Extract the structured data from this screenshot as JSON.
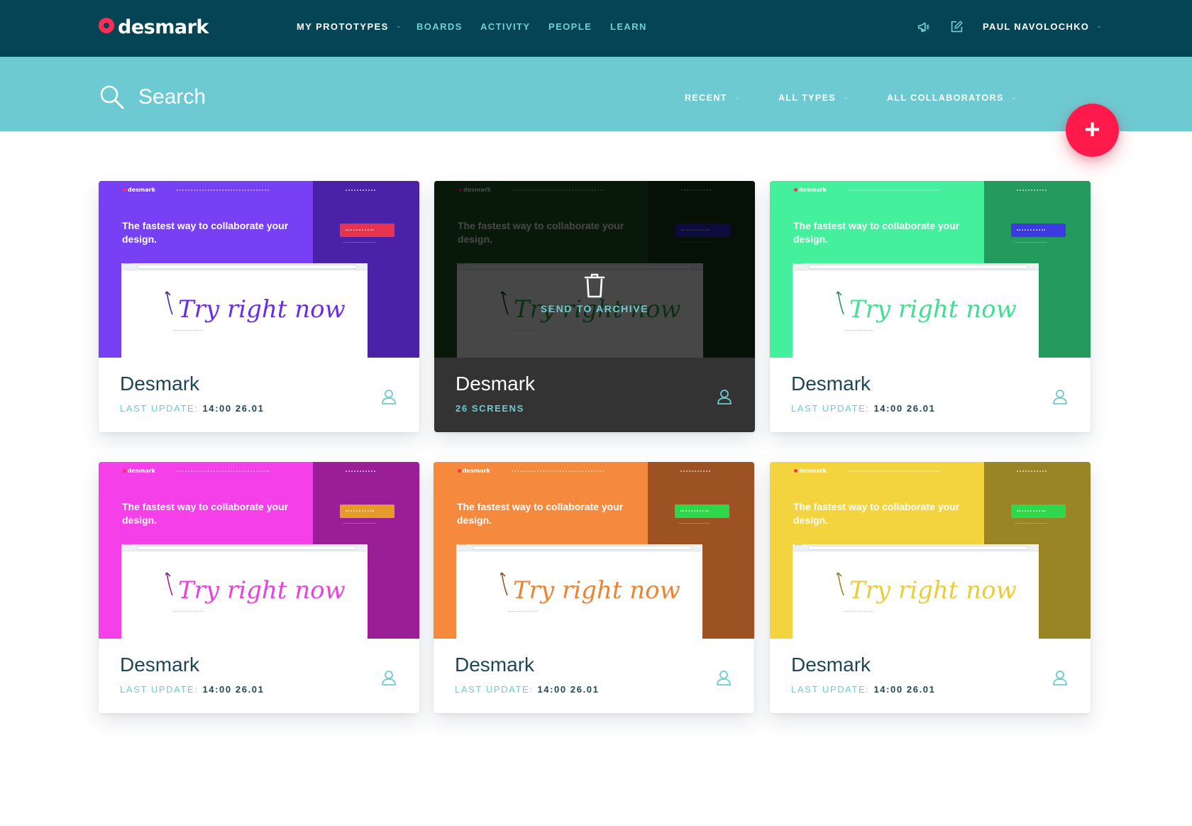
{
  "app": {
    "logo_text": "desmark"
  },
  "nav": {
    "items": [
      {
        "label": "MY PROTOTYPES",
        "has_dropdown": true,
        "active": true
      },
      {
        "label": "BOARDS"
      },
      {
        "label": "ACTIVITY"
      },
      {
        "label": "PEOPLE"
      },
      {
        "label": "LEARN"
      }
    ],
    "icons": [
      "megaphone-icon",
      "edit-icon"
    ],
    "user": {
      "name": "PAUL NAVOLOCHKO"
    }
  },
  "search": {
    "placeholder": "Search",
    "value": "",
    "filters": [
      {
        "label": "RECENT"
      },
      {
        "label": "ALL TYPES"
      },
      {
        "label": "ALL COLLABORATORS"
      }
    ]
  },
  "fab": {
    "label": "+"
  },
  "preview": {
    "logo": "desmark",
    "tagline": "The fastest way to collaborate your design.",
    "script_text": "Try right now"
  },
  "cards": [
    {
      "title": "Desmark",
      "meta_label": "LAST UPDATE:",
      "meta_value": "14:00 26.01",
      "main_color": "#7740f5",
      "side_color": "#4a22a8",
      "cta_color": "#e8334f",
      "script_color": "#6a2bf0"
    },
    {
      "title": "Desmark",
      "meta_label": "26 SCREENS",
      "meta_value": "",
      "hovered": true,
      "action_label": "SEND TO ARCHIVE",
      "main_color": "#1f5a26",
      "side_color": "#123a16",
      "cta_color": "#2b2bd6",
      "script_color": "#2aa94a"
    },
    {
      "title": "Desmark",
      "meta_label": "LAST UPDATE:",
      "meta_value": "14:00 26.01",
      "main_color": "#44f09c",
      "side_color": "#249a5c",
      "cta_color": "#3a3ae0",
      "script_color": "#3de08e"
    },
    {
      "title": "Desmark",
      "meta_label": "LAST UPDATE:",
      "meta_value": "14:00 26.01",
      "main_color": "#f53fe9",
      "side_color": "#9a1f96",
      "cta_color": "#e59a2a",
      "script_color": "#ec3fe0"
    },
    {
      "title": "Desmark",
      "meta_label": "LAST UPDATE:",
      "meta_value": "14:00 26.01",
      "main_color": "#f58a3e",
      "side_color": "#9c5222",
      "cta_color": "#2ed84a",
      "script_color": "#f0822f"
    },
    {
      "title": "Desmark",
      "meta_label": "LAST UPDATE:",
      "meta_value": "14:00 26.01",
      "main_color": "#f3d43e",
      "side_color": "#9a8526",
      "cta_color": "#2ed84a",
      "script_color": "#eccc36"
    }
  ]
}
